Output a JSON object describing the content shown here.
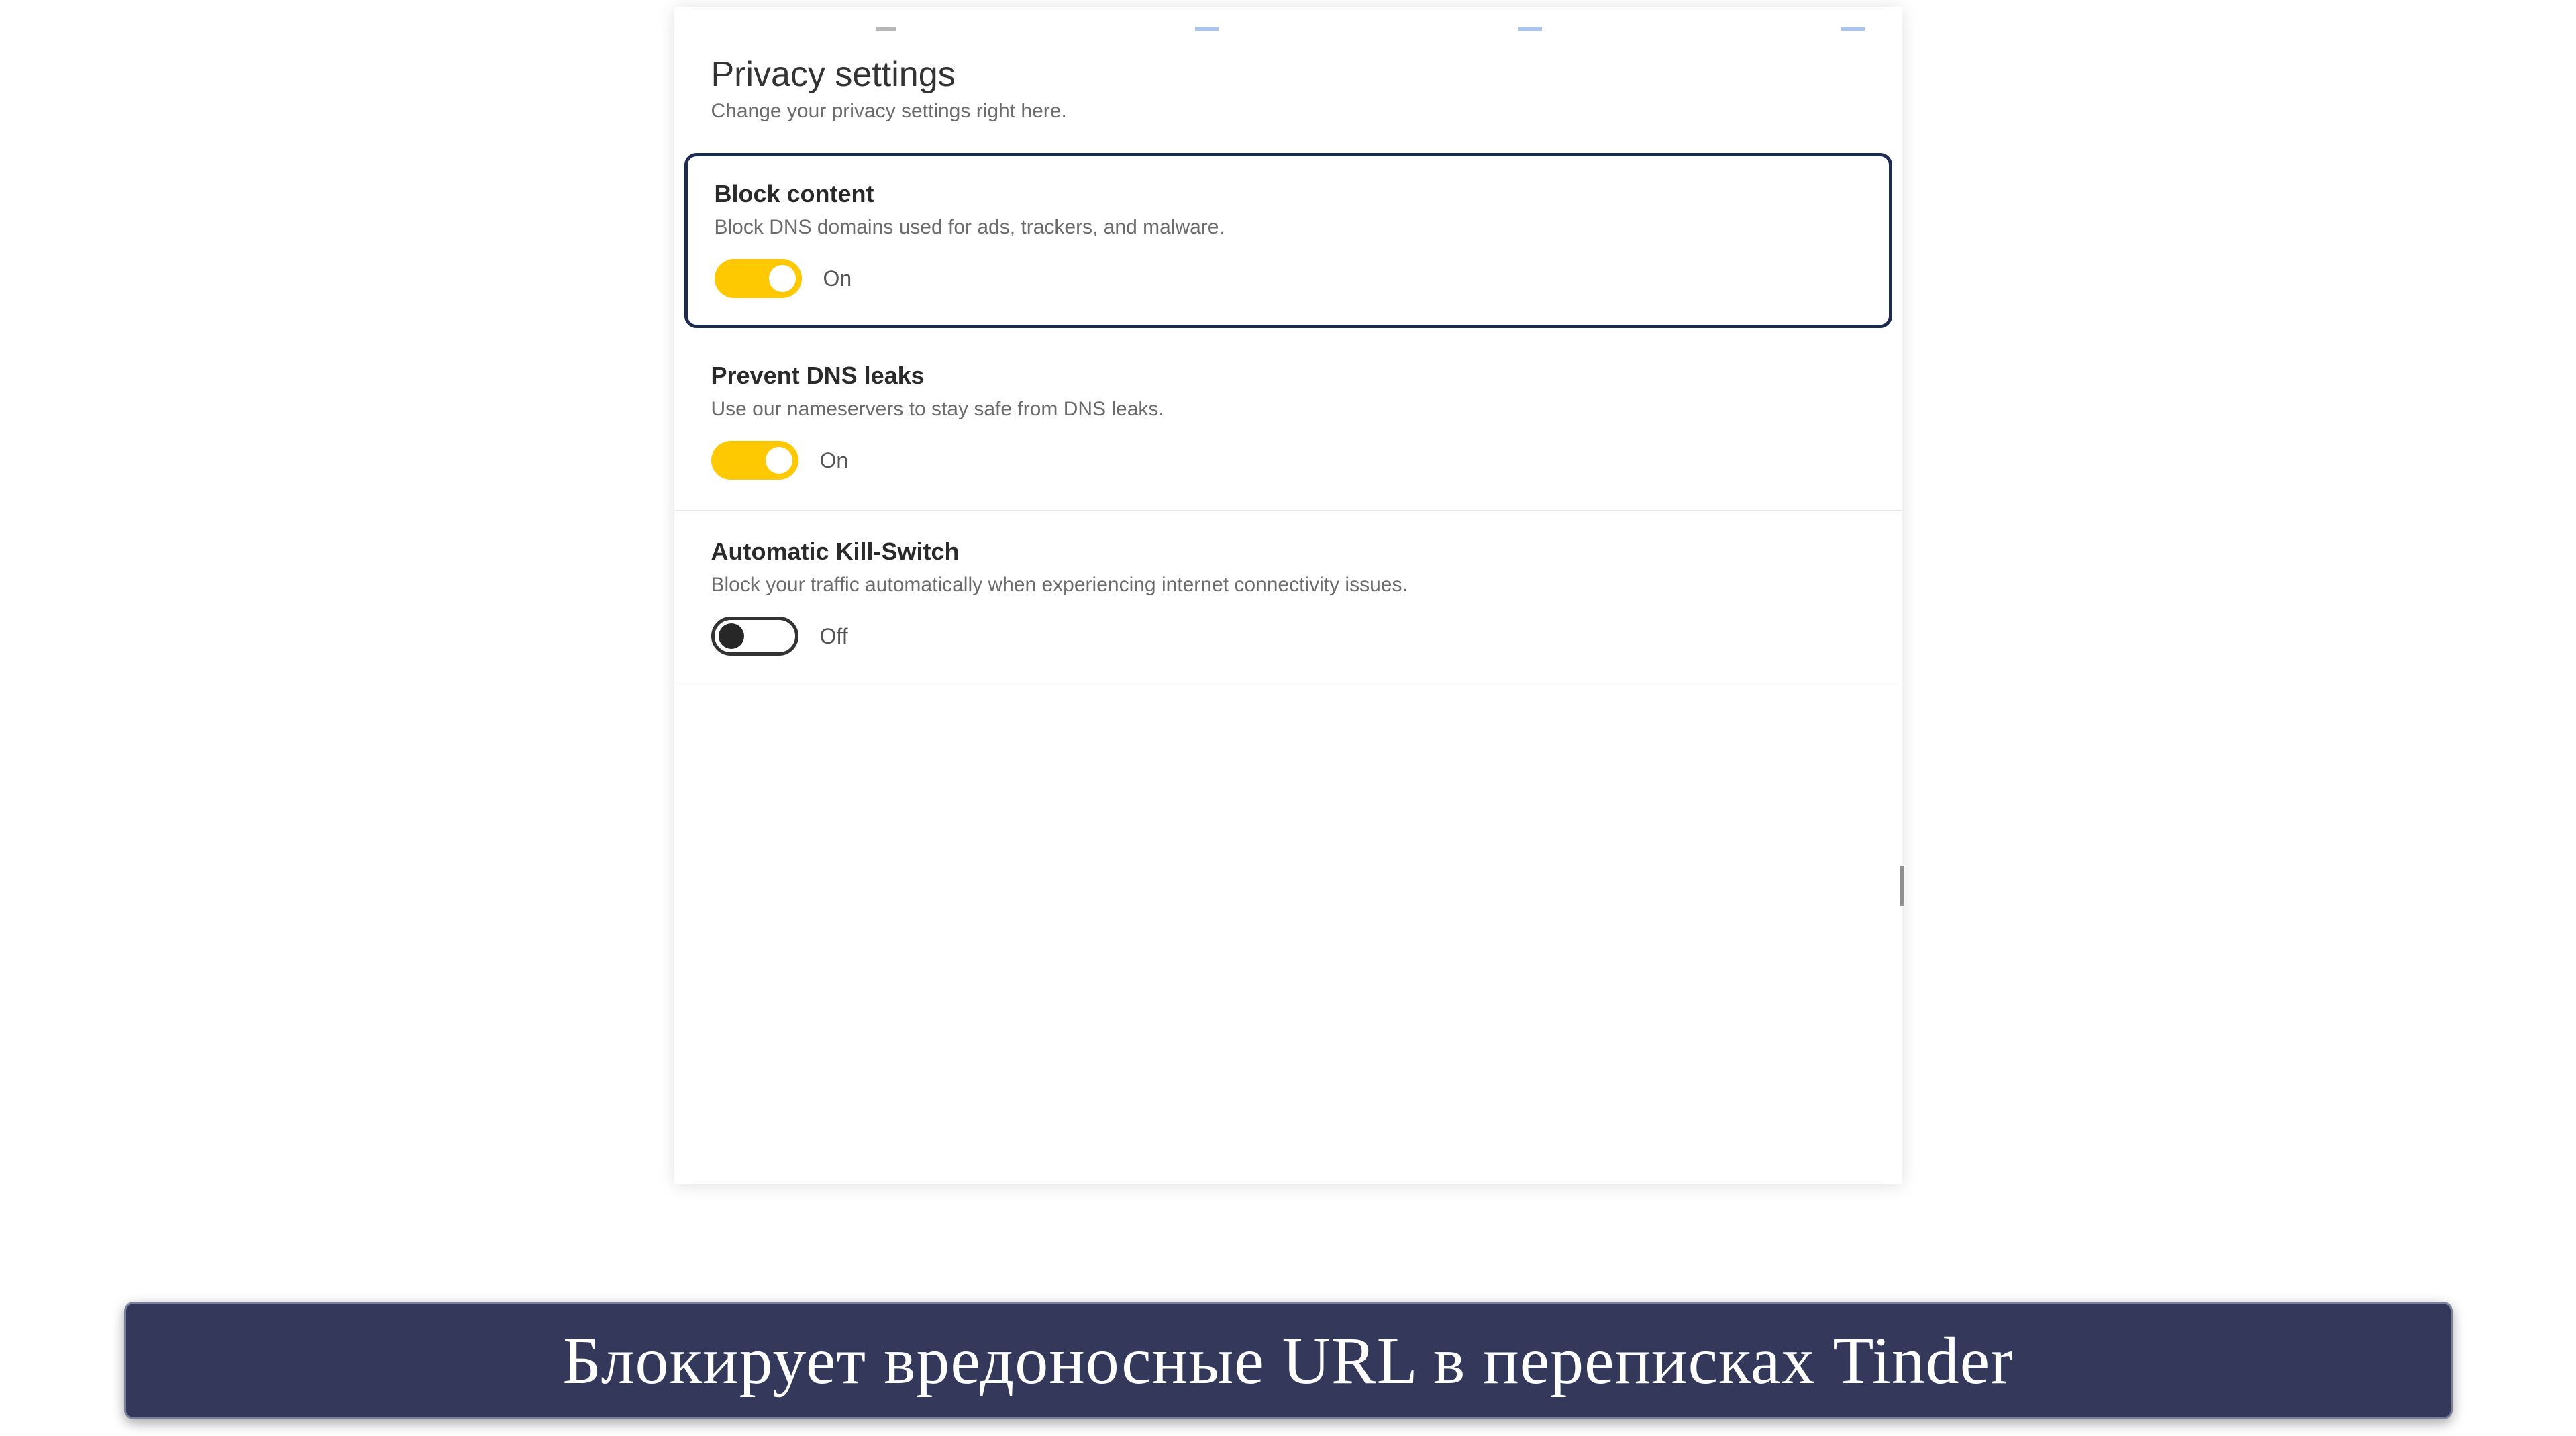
{
  "header": {
    "title": "Privacy settings",
    "subtitle": "Change your privacy settings right here."
  },
  "settings": [
    {
      "title": "Block content",
      "description": "Block DNS domains used for ads, trackers, and malware.",
      "state_label": "On",
      "on": true,
      "highlighted": true
    },
    {
      "title": "Prevent DNS leaks",
      "description": "Use our nameservers to stay safe from DNS leaks.",
      "state_label": "On",
      "on": true,
      "highlighted": false
    },
    {
      "title": "Automatic Kill-Switch",
      "description": "Block your traffic automatically when experiencing internet connectivity issues.",
      "state_label": "Off",
      "on": false,
      "highlighted": false
    }
  ],
  "caption": "Блокирует вредоносные URL в переписках Tinder"
}
